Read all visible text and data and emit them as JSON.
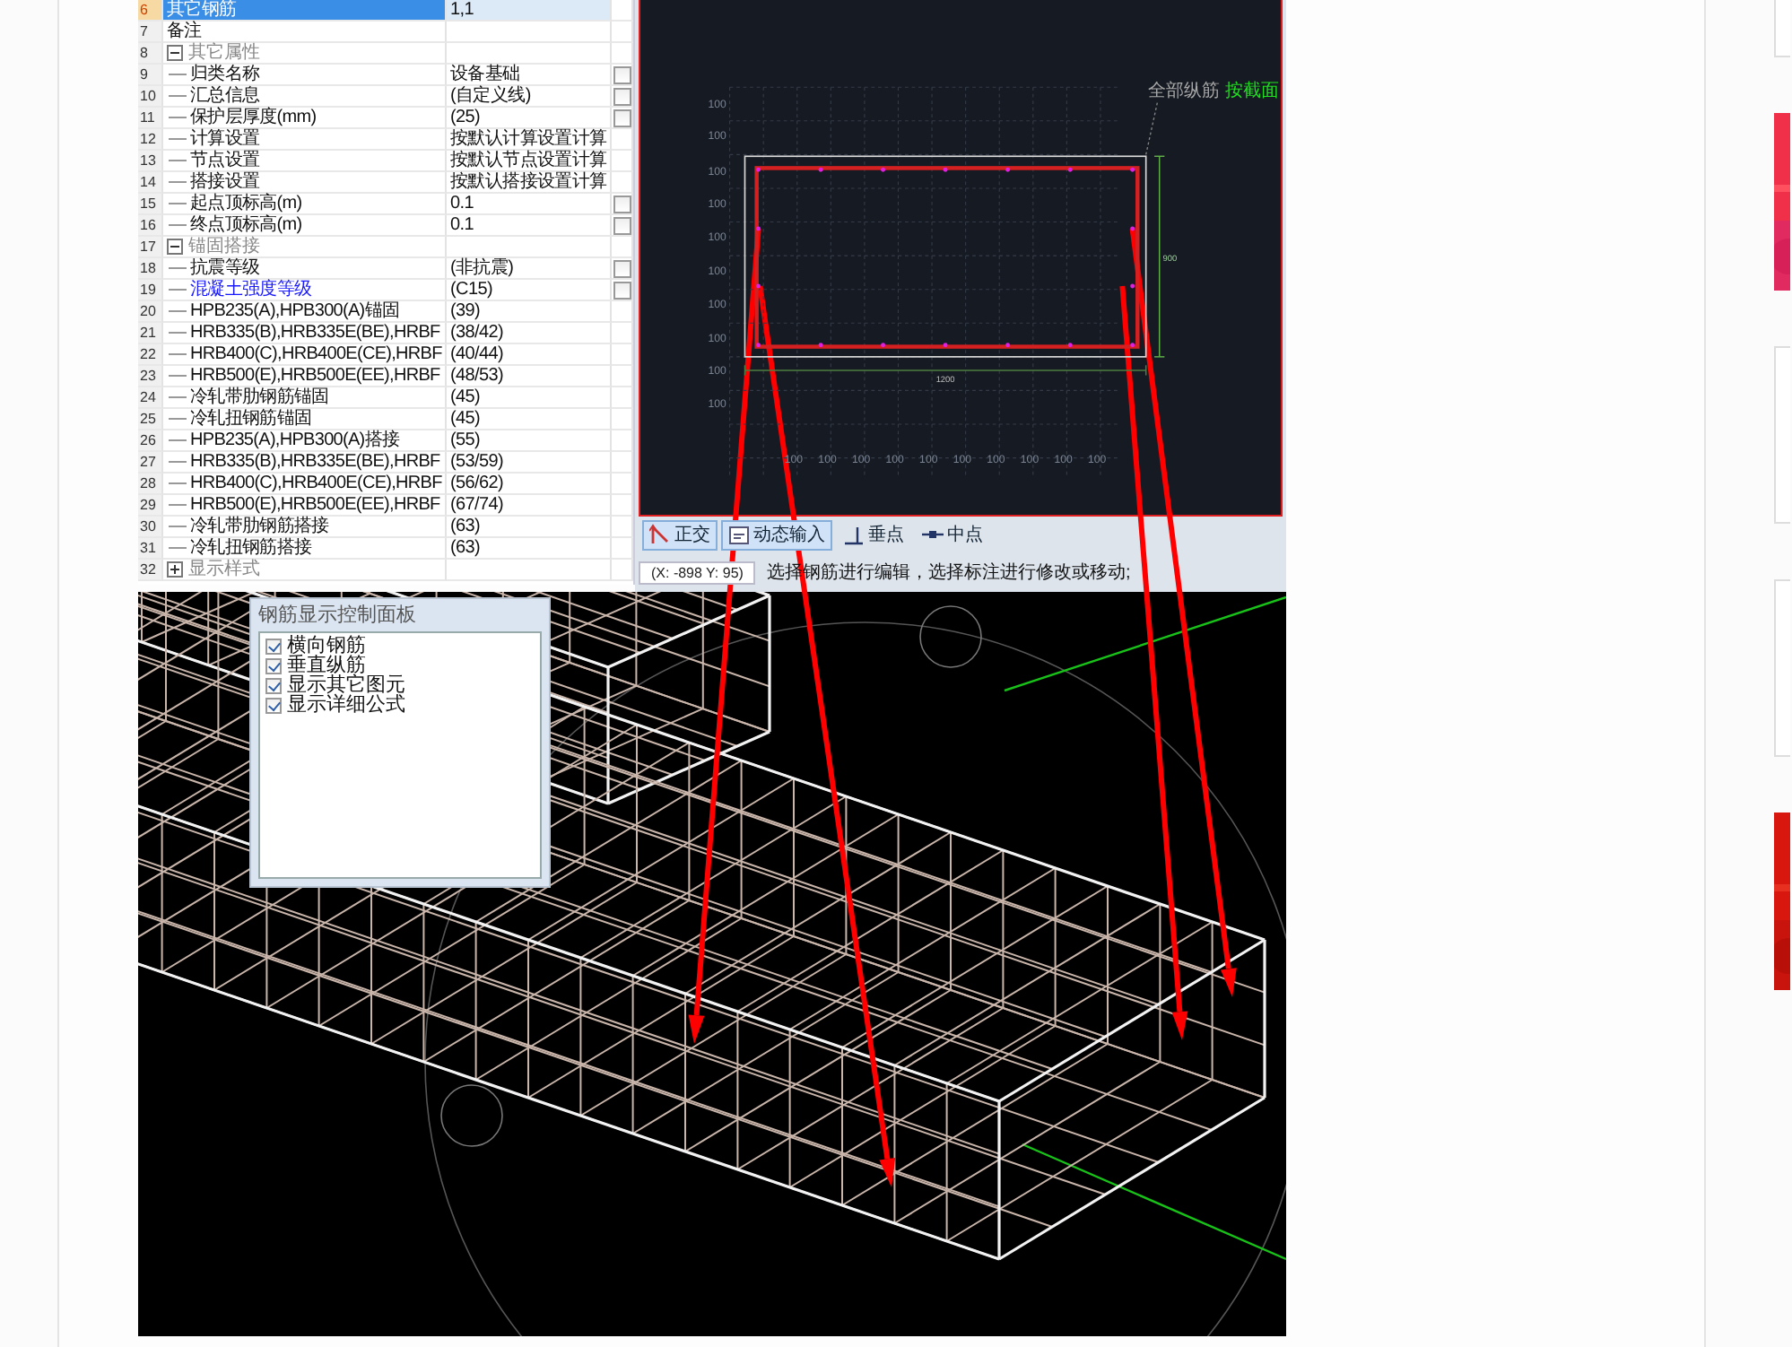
{
  "property_table": {
    "rows": [
      {
        "number": "6",
        "name": "其它钢筋",
        "value": "1,1",
        "selected": true
      },
      {
        "number": "7",
        "name": "备注",
        "selected": false
      },
      {
        "number": "8",
        "name": "其它属性",
        "kind": "group",
        "expanded": true,
        "selected": false,
        "children": [
          {
            "number": "9",
            "name": "归类名称",
            "value": "设备基础",
            "checked": false,
            "selected": false
          },
          {
            "number": "10",
            "name": "汇总信息",
            "value": "(自定义线)",
            "checked": false,
            "selected": false
          },
          {
            "number": "11",
            "name": "保护层厚度(mm)",
            "value": "(25)",
            "checked": false,
            "selected": false
          },
          {
            "number": "12",
            "name": "计算设置",
            "value": "按默认计算设置计算",
            "selected": false
          },
          {
            "number": "13",
            "name": "节点设置",
            "value": "按默认节点设置计算",
            "selected": false
          },
          {
            "number": "14",
            "name": "搭接设置",
            "value": "按默认搭接设置计算",
            "selected": false
          },
          {
            "number": "15",
            "name": "起点顶标高(m)",
            "value": "0.1",
            "checked": false,
            "selected": false
          },
          {
            "number": "16",
            "name": "终点顶标高(m)",
            "value": "0.1",
            "checked": false,
            "selected": false
          }
        ]
      },
      {
        "number": "17",
        "name": "锚固搭接",
        "kind": "group",
        "expanded": true,
        "selected": false,
        "children": [
          {
            "number": "18",
            "name": "抗震等级",
            "value": "(非抗震)",
            "checked": false,
            "selected": false
          },
          {
            "number": "19",
            "name": "混凝土强度等级",
            "value": "(C15)",
            "checked": false,
            "selected": false,
            "color": "#1a1aff"
          },
          {
            "number": "20",
            "name": "HPB235(A),HPB300(A)锚固",
            "value": "(39)",
            "selected": false
          },
          {
            "number": "21",
            "name": "HRB335(B),HRB335E(BE),HRBF",
            "value": "(38/42)",
            "selected": false
          },
          {
            "number": "22",
            "name": "HRB400(C),HRB400E(CE),HRBF",
            "value": "(40/44)",
            "selected": false
          },
          {
            "number": "23",
            "name": "HRB500(E),HRB500E(EE),HRBF",
            "value": "(48/53)",
            "selected": false
          },
          {
            "number": "24",
            "name": "冷轧带肋钢筋锚固",
            "value": "(45)",
            "selected": false
          },
          {
            "number": "25",
            "name": "冷轧扭钢筋锚固",
            "value": "(45)",
            "selected": false
          },
          {
            "number": "26",
            "name": "HPB235(A),HPB300(A)搭接",
            "value": "(55)",
            "selected": false
          },
          {
            "number": "27",
            "name": "HRB335(B),HRB335E(BE),HRBF",
            "value": "(53/59)",
            "selected": false
          },
          {
            "number": "28",
            "name": "HRB400(C),HRB400E(CE),HRBF",
            "value": "(56/62)",
            "selected": false
          },
          {
            "number": "29",
            "name": "HRB500(E),HRB500E(EE),HRBF",
            "value": "(67/74)",
            "selected": false
          },
          {
            "number": "30",
            "name": "冷轧带肋钢筋搭接",
            "value": "(63)",
            "selected": false
          },
          {
            "number": "31",
            "name": "冷轧扭钢筋搭接",
            "value": "(63)",
            "selected": false
          }
        ]
      },
      {
        "number": "32",
        "name": "显示样式",
        "kind": "group",
        "expanded": false,
        "selected": false
      }
    ]
  },
  "drawing_panel": {
    "y_labels": [
      "100",
      "100",
      "100",
      "100",
      "100",
      "100",
      "100",
      "100",
      "100",
      "100"
    ],
    "x_labels": [
      "100",
      "100",
      "100",
      "100",
      "100",
      "100",
      "100",
      "100",
      "100",
      "100"
    ],
    "width_dimension": "1200",
    "height_dimension": "900",
    "leader_label": "全部纵筋",
    "leader_mode": "按截面",
    "toolbar": [
      {
        "label": "正交",
        "kind": "ortho",
        "pressed": true
      },
      {
        "label": "动态输入",
        "kind": "dynamic-input",
        "pressed": true
      },
      {
        "label": "垂点",
        "kind": "perpendicular",
        "pressed": false
      },
      {
        "label": "中点",
        "kind": "midpoint",
        "pressed": false
      }
    ],
    "status_bar": {
      "coordinates": "(X: -898 Y: 95)",
      "message": "选择钢筋进行编辑，选择标注进行修改或移动;"
    }
  },
  "view_3d": {
    "panel": {
      "title": "钢筋显示控制面板",
      "options": [
        {
          "label": "横向钢筋",
          "checked": true
        },
        {
          "label": "垂直纵筋",
          "checked": true
        },
        {
          "label": "显示其它图元",
          "checked": true
        },
        {
          "label": "显示详细公式",
          "checked": true
        }
      ]
    }
  },
  "side_rail": {
    "cards": [
      {
        "kind": "blank"
      },
      {
        "kind": "picture"
      },
      {
        "kind": "blank"
      },
      {
        "kind": "blank"
      },
      {
        "kind": "picture"
      }
    ]
  }
}
